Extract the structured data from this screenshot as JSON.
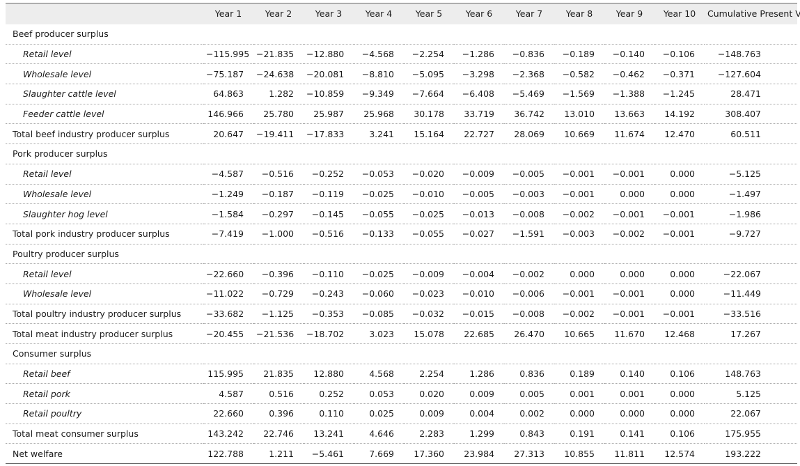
{
  "header": [
    "",
    "Year 1",
    "Year 2",
    "Year 3",
    "Year 4",
    "Year 5",
    "Year 6",
    "Year 7",
    "Year 8",
    "Year 9",
    "Year 10",
    "Cumulative Present Value"
  ],
  "rows": [
    {
      "kind": "section",
      "label": "Beef producer surplus",
      "values": []
    },
    {
      "kind": "sub",
      "label": "Retail level",
      "values": [
        "−115.995",
        "−21.835",
        "−12.880",
        "−4.568",
        "−2.254",
        "−1.286",
        "−0.836",
        "−0.189",
        "−0.140",
        "−0.106",
        "−148.763"
      ]
    },
    {
      "kind": "sub",
      "label": "Wholesale level",
      "values": [
        "−75.187",
        "−24.638",
        "−20.081",
        "−8.810",
        "−5.095",
        "−3.298",
        "−2.368",
        "−0.582",
        "−0.462",
        "−0.371",
        "−127.604"
      ]
    },
    {
      "kind": "sub",
      "label": "Slaughter cattle level",
      "values": [
        "64.863",
        "1.282",
        "−10.859",
        "−9.349",
        "−7.664",
        "−6.408",
        "−5.469",
        "−1.569",
        "−1.388",
        "−1.245",
        "28.471"
      ]
    },
    {
      "kind": "sub",
      "label": "Feeder cattle level",
      "values": [
        "146.966",
        "25.780",
        "25.987",
        "25.968",
        "30.178",
        "33.719",
        "36.742",
        "13.010",
        "13.663",
        "14.192",
        "308.407"
      ]
    },
    {
      "kind": "total",
      "label": "Total beef industry producer surplus",
      "values": [
        "20.647",
        "−19.411",
        "−17.833",
        "3.241",
        "15.164",
        "22.727",
        "28.069",
        "10.669",
        "11.674",
        "12.470",
        "60.511"
      ]
    },
    {
      "kind": "section",
      "label": "Pork producer surplus",
      "values": []
    },
    {
      "kind": "sub",
      "label": "Retail level",
      "values": [
        "−4.587",
        "−0.516",
        "−0.252",
        "−0.053",
        "−0.020",
        "−0.009",
        "−0.005",
        "−0.001",
        "−0.001",
        "0.000",
        "−5.125"
      ]
    },
    {
      "kind": "sub",
      "label": "Wholesale level",
      "values": [
        "−1.249",
        "−0.187",
        "−0.119",
        "−0.025",
        "−0.010",
        "−0.005",
        "−0.003",
        "−0.001",
        "0.000",
        "0.000",
        "−1.497"
      ]
    },
    {
      "kind": "sub",
      "label": "Slaughter hog level",
      "values": [
        "−1.584",
        "−0.297",
        "−0.145",
        "−0.055",
        "−0.025",
        "−0.013",
        "−0.008",
        "−0.002",
        "−0.001",
        "−0.001",
        "−1.986"
      ]
    },
    {
      "kind": "total",
      "label": "Total pork industry producer surplus",
      "values": [
        "−7.419",
        "−1.000",
        "−0.516",
        "−0.133",
        "−0.055",
        "−0.027",
        "−1.591",
        "−0.003",
        "−0.002",
        "−0.001",
        "−9.727"
      ]
    },
    {
      "kind": "section",
      "label": "Poultry producer surplus",
      "values": []
    },
    {
      "kind": "sub",
      "label": "Retail level",
      "values": [
        "−22.660",
        "−0.396",
        "−0.110",
        "−0.025",
        "−0.009",
        "−0.004",
        "−0.002",
        "0.000",
        "0.000",
        "0.000",
        "−22.067"
      ]
    },
    {
      "kind": "sub",
      "label": "Wholesale level",
      "values": [
        "−11.022",
        "−0.729",
        "−0.243",
        "−0.060",
        "−0.023",
        "−0.010",
        "−0.006",
        "−0.001",
        "−0.001",
        "0.000",
        "−11.449"
      ]
    },
    {
      "kind": "total",
      "label": "Total poultry industry producer surplus",
      "values": [
        "−33.682",
        "−1.125",
        "−0.353",
        "−0.085",
        "−0.032",
        "−0.015",
        "−0.008",
        "−0.002",
        "−0.001",
        "−0.001",
        "−33.516"
      ]
    },
    {
      "kind": "total",
      "label": "Total meat industry producer surplus",
      "values": [
        "−20.455",
        "−21.536",
        "−18.702",
        "3.023",
        "15.078",
        "22.685",
        "26.470",
        "10.665",
        "11.670",
        "12.468",
        "17.267"
      ]
    },
    {
      "kind": "section",
      "label": "Consumer surplus",
      "values": []
    },
    {
      "kind": "sub",
      "label": "Retail beef",
      "values": [
        "115.995",
        "21.835",
        "12.880",
        "4.568",
        "2.254",
        "1.286",
        "0.836",
        "0.189",
        "0.140",
        "0.106",
        "148.763"
      ]
    },
    {
      "kind": "sub",
      "label": "Retail pork",
      "values": [
        "4.587",
        "0.516",
        "0.252",
        "0.053",
        "0.020",
        "0.009",
        "0.005",
        "0.001",
        "0.001",
        "0.000",
        "5.125"
      ]
    },
    {
      "kind": "sub",
      "label": "Retail poultry",
      "values": [
        "22.660",
        "0.396",
        "0.110",
        "0.025",
        "0.009",
        "0.004",
        "0.002",
        "0.000",
        "0.000",
        "0.000",
        "22.067"
      ]
    },
    {
      "kind": "total",
      "label": "Total meat consumer surplus",
      "values": [
        "143.242",
        "22.746",
        "13.241",
        "4.646",
        "2.283",
        "1.299",
        "0.843",
        "0.191",
        "0.141",
        "0.106",
        "175.955"
      ]
    },
    {
      "kind": "total",
      "label": "Net welfare",
      "values": [
        "122.788",
        "1.211",
        "−5.461",
        "7.669",
        "17.360",
        "23.984",
        "27.313",
        "10.855",
        "11.811",
        "12.574",
        "193.222"
      ]
    }
  ]
}
